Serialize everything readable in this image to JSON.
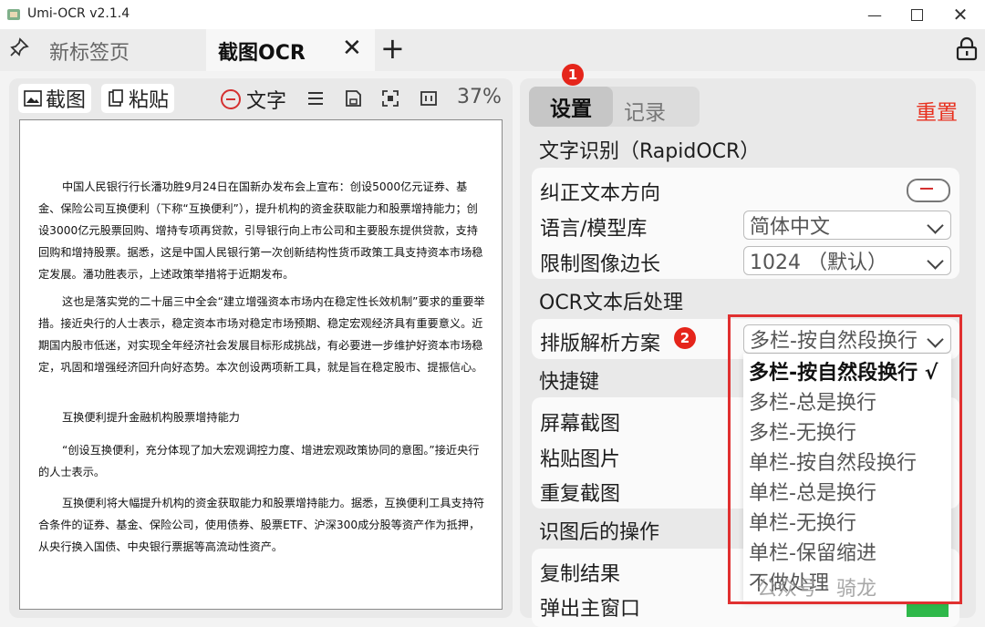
{
  "window": {
    "title": "Umi-OCR v2.1.4"
  },
  "tabs": {
    "new_tab": "新标签页",
    "active_tab": "截图OCR"
  },
  "left_toolbar": {
    "screenshot": "截图",
    "paste": "粘贴",
    "text": "文字",
    "zoom": "37%"
  },
  "document": {
    "paragraphs": [
      "中国人民银行行长潘功胜9月24日在国新办发布会上宣布：创设5000亿元证券、基金、保险公司互换便利（下称“互换便利”），提升机构的资金获取能力和股票增持能力；创设3000亿元股票回购、增持专项再贷款，引导银行向上市公司和主要股东提供贷款，支持回购和增持股票。据悉，这是中国人民银行第一次创新结构性货币政策工具支持资本市场稳定发展。潘功胜表示，上述政策举措将于近期发布。",
      "这也是落实党的二十届三中全会“建立增强资本市场内在稳定性长效机制”要求的重要举措。接近央行的人士表示，稳定资本市场对稳定市场预期、稳定宏观经济具有重要意义。近期国内股市低迷，对实现全年经济社会发展目标形成挑战，有必要进一步维护好资本市场稳定，巩固和增强经济回升向好态势。本次创设两项新工具，就是旨在稳定股市、提振信心。",
      "互换便利提升金融机构股票增持能力",
      "“创设互换便利，充分体现了加大宏观调控力度、增进宏观政策协同的意图。”接近央行的人士表示。",
      "互换便利将大幅提升机构的资金获取能力和股票增持能力。据悉，互换便利工具支持符合条件的证券、基金、保险公司，使用债券、股票ETF、沪深300成分股等资产作为抵押，从央行换入国债、中央银行票据等高流动性资产。"
    ]
  },
  "settings": {
    "tab_settings": "设置",
    "tab_records": "记录",
    "reset": "重置",
    "badge1": "1",
    "badge2": "2",
    "section_ocr": "文字识别（RapidOCR）",
    "correct_direction": "纠正文本方向",
    "language_label": "语言/模型库",
    "language_value": "简体中文",
    "limit_label": "限制图像边长",
    "limit_value": "1024 （默认）",
    "section_post": "OCR文本后处理",
    "layout_label": "排版解析方案",
    "layout_value": "多栏-按自然段换行",
    "section_hotkey": "快捷键",
    "hotkey_screenshot": "屏幕截图",
    "hotkey_paste": "粘贴图片",
    "hotkey_repeat": "重复截图",
    "section_after": "识图后的操作",
    "copy_result": "复制结果",
    "popup_window": "弹出主窗口"
  },
  "dropdown": {
    "options": [
      "多栏-按自然段换行 √",
      "多栏-总是换行",
      "多栏-无换行",
      "单栏-按自然段换行",
      "单栏-总是换行",
      "单栏-无换行",
      "单栏-保留缩进",
      "不做处理"
    ]
  },
  "watermark": "公众号 · 骑龙",
  "colors": {
    "accent_red": "#e8301e",
    "highlight_border": "#e03030",
    "confirm_green": "#2eb84a"
  }
}
